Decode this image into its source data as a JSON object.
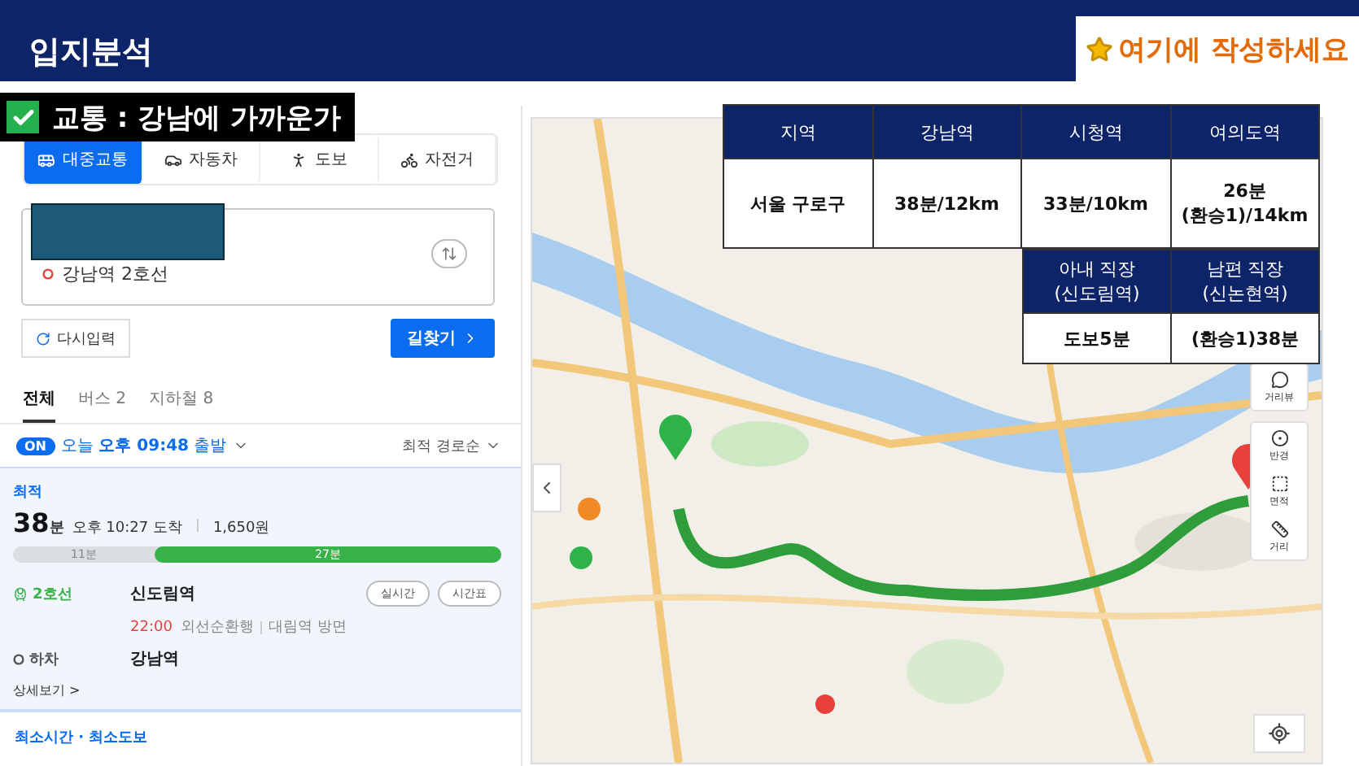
{
  "header": {
    "title": "입지분석",
    "note": "여기에 작성하세요"
  },
  "section_label": {
    "text": "교통 : 강남에 가까운가",
    "checked": true
  },
  "route_panel": {
    "modes": [
      {
        "kind": "transit",
        "label": "대중교통",
        "selected": true
      },
      {
        "kind": "car",
        "label": "자동차",
        "selected": false
      },
      {
        "kind": "walk",
        "label": "도보",
        "selected": false
      },
      {
        "kind": "bike",
        "label": "자전거",
        "selected": false
      }
    ],
    "destination": "강남역 2호선",
    "reset_button": "다시입력",
    "search_button": "길찾기",
    "result_tabs": [
      {
        "label": "전체",
        "selected": true
      },
      {
        "label": "버스 2",
        "selected": false
      },
      {
        "label": "지하철 8",
        "selected": false
      }
    ],
    "departure": {
      "toggle": "ON",
      "on": true,
      "day": "오늘",
      "time": "오후 09:48",
      "suffix": "출발"
    },
    "sort": "최적 경로순",
    "route": {
      "badge": "최적",
      "minutes": "38",
      "unit": "분",
      "arrival": "오후 10:27 도착",
      "fare": "1,650원",
      "timeline": {
        "walk_label": "11분",
        "subway_label": "27분",
        "level": 0.71
      },
      "line": "2호선",
      "board_station": "신도림역",
      "buttons": [
        "실시간",
        "시간표"
      ],
      "departure_time": "22:00",
      "direction": "외선순환행",
      "toward": "대림역 방면",
      "alight_label": "하차",
      "alight_station": "강남역",
      "details_link": "상세보기 >"
    },
    "next_route_title": "최소시간 · 최소도보"
  },
  "map": {
    "kind": "picture",
    "tools": [
      {
        "kind": "streetview",
        "label": "거리뷰"
      },
      {
        "kind": "radius",
        "label": "반경"
      },
      {
        "kind": "area",
        "label": "면적"
      },
      {
        "kind": "distance",
        "label": "거리"
      }
    ]
  },
  "commute_table": {
    "columns": [
      "지역",
      "강남역",
      "시청역",
      "여의도역"
    ],
    "rows": [
      [
        "서울 구로구",
        "38분/12km",
        "33분/10km",
        "26분 (환승1)/14km"
      ]
    ]
  },
  "workplace_table": {
    "columns": [
      "아내 직장 (신도림역)",
      "남편 직장 (신논현역)"
    ],
    "rows": [
      [
        "도보5분",
        "(환승1)38분"
      ]
    ]
  }
}
